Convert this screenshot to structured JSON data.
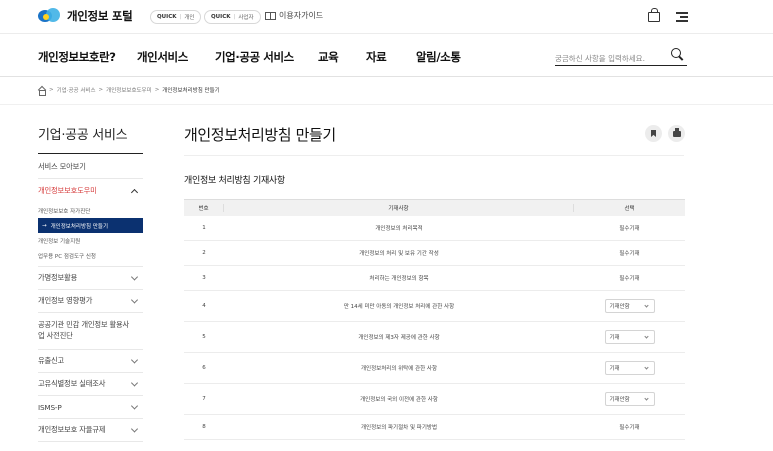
{
  "topbar": {
    "logo_text": "개인정보 포털",
    "quick1": {
      "badge": "QUICK",
      "label": "개인"
    },
    "quick2": {
      "badge": "QUICK",
      "label": "사업자"
    },
    "guide_label": "이용자가이드"
  },
  "nav": {
    "items": [
      "개인정보보호란?",
      "개인서비스",
      "기업·공공 서비스",
      "교육",
      "자료",
      "알림/소통"
    ],
    "active_index": 2,
    "search_placeholder": "궁금하신 사항을 입력하세요."
  },
  "breadcrumb": [
    "기업·공공 서비스",
    "개인정보보호도우미",
    "개인정보처리방침 만들기"
  ],
  "sidebar": {
    "title": "기업·공공 서비스",
    "items": [
      {
        "label": "서비스 모아보기"
      },
      {
        "label": "개인정보보호도우미"
      },
      {
        "label": "가명정보활용"
      },
      {
        "label": "개인정보 영향평가"
      },
      {
        "label": "공공기관 민감 개인정보 활용사업 사전진단"
      },
      {
        "label": "유출신고"
      },
      {
        "label": "고유식별정보 실태조사"
      },
      {
        "label": "ISMS-P"
      },
      {
        "label": "개인정보보호 자율규제"
      }
    ],
    "subitems": [
      "개인정보보호 자가진단",
      "개인정보처리방침 만들기",
      "개인정보 기술지원",
      "업무용 PC 점검도구 신청"
    ],
    "active_sub": 1,
    "active_arrow": "→"
  },
  "main": {
    "title": "개인정보처리방침 만들기",
    "section_title": "개인정보 처리방침 기재사항",
    "table": {
      "headers": [
        "번호",
        "기재사항",
        "선택"
      ],
      "rows": [
        {
          "no": "1",
          "item": "개인정보의 처리목적",
          "choice": "필수기재",
          "type": "text"
        },
        {
          "no": "2",
          "item": "개인정보의 처리 및 보유 기간 작성",
          "choice": "필수기재",
          "type": "text"
        },
        {
          "no": "3",
          "item": "처리하는 개인정보의 항목",
          "choice": "필수기재",
          "type": "text"
        },
        {
          "no": "4",
          "item": "만 14세 미만 아동의 개인정보 처리에 관한 사항",
          "choice": "기재안함",
          "type": "select"
        },
        {
          "no": "5",
          "item": "개인정보의 제3자 제공에 관한 사항",
          "choice": "기재",
          "type": "select"
        },
        {
          "no": "6",
          "item": "개인정보처리의 위탁에 관한 사항",
          "choice": "기재",
          "type": "select"
        },
        {
          "no": "7",
          "item": "개인정보의 국외 이전에 관한 사항",
          "choice": "기재안함",
          "type": "select"
        },
        {
          "no": "8",
          "item": "개인정보의 파기절차 및 파기방법",
          "choice": "필수기재",
          "type": "text"
        }
      ]
    }
  },
  "colors": {
    "accent_highlight": "#c6f23a",
    "active_sub_bg": "#0b3170",
    "open_item": "#d63b3b"
  }
}
